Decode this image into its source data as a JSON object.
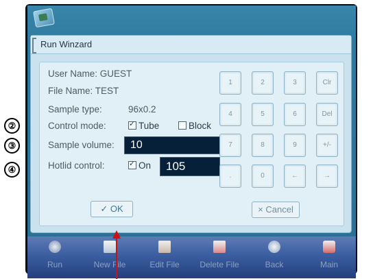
{
  "dialog": {
    "title": "Run Winzard"
  },
  "info": {
    "user_name": "User Name: GUEST",
    "file_name": "File Name:  TEST",
    "sample_type_label": "Sample type:",
    "sample_type_value": "96x0.2",
    "control_mode_label": "Control mode:",
    "tube_label": "Tube",
    "block_label": "Block",
    "sample_volume_label": "Sample volume:",
    "sample_volume_value": "10",
    "hotlid_label": "Hotlid control:",
    "on_label": "On",
    "hotlid_value": "105"
  },
  "keypad": [
    "1",
    "2",
    "3",
    "Clr",
    "4",
    "5",
    "6",
    "Del",
    "7",
    "8",
    "9",
    "+/-",
    ".",
    "0",
    "←",
    "→"
  ],
  "buttons": {
    "ok": "✓ OK",
    "cancel": "× Cancel"
  },
  "toolbar": [
    "Run",
    "New File",
    "Edit File",
    "Delete File",
    "Back",
    "Main"
  ],
  "markers": [
    "②",
    "③",
    "④"
  ],
  "checkbox_state": {
    "tube": true,
    "block": false,
    "on": true
  },
  "icons": [
    "app-logo-icon",
    "run-icon",
    "new-file-icon",
    "edit-file-icon",
    "delete-file-icon",
    "back-icon",
    "main-icon"
  ]
}
